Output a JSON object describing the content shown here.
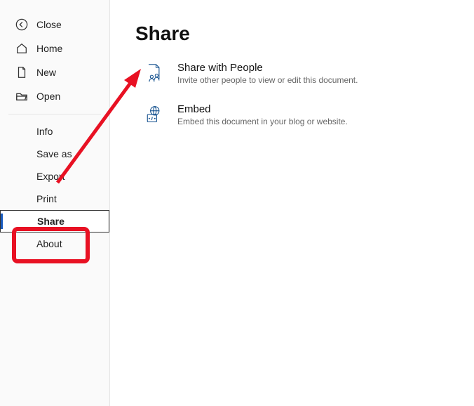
{
  "sidebar": {
    "close": "Close",
    "home": "Home",
    "new": "New",
    "open": "Open",
    "info": "Info",
    "saveas": "Save as",
    "export": "Export",
    "print": "Print",
    "share": "Share",
    "about": "About"
  },
  "page": {
    "title": "Share"
  },
  "options": {
    "sharePeople": {
      "title": "Share with People",
      "desc": "Invite other people to view or edit this document."
    },
    "embed": {
      "title": "Embed",
      "desc": "Embed this document in your blog or website."
    }
  },
  "colors": {
    "annotation": "#e81123",
    "iconBlue": "#0b4a8a"
  }
}
